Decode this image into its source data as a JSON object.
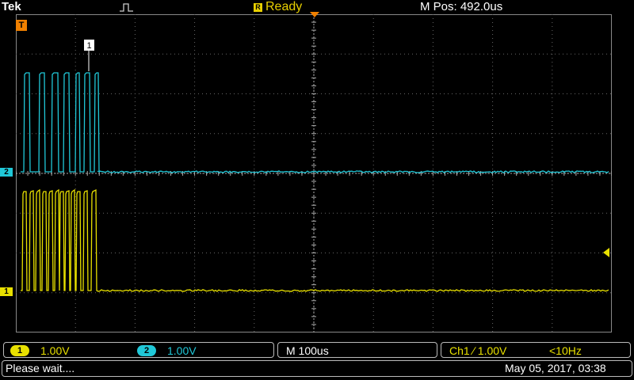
{
  "header": {
    "brand": "Tek",
    "status": "Ready",
    "status_icon": "R",
    "mpos": "M Pos: 492.0us"
  },
  "markers": {
    "trigger_point": "T",
    "ch2": "2",
    "ch1": "1",
    "callout": "1"
  },
  "colors": {
    "ch1": "#e8e000",
    "ch2": "#20c8d8",
    "trigger": "#f08000"
  },
  "footer": {
    "ch1_badge": "1",
    "ch1_scale": "1.00V",
    "ch2_badge": "2",
    "ch2_scale": "1.00V",
    "timebase": "M 100us",
    "trigger": "Ch1 ∕ 1.00V",
    "freq": "<10Hz",
    "message": "Please wait....",
    "datetime": "May 05, 2017, 03:38"
  },
  "icons": {
    "trigger_type": "edge-pulse-icon",
    "trigger_level": "trigger-level-arrow-icon",
    "trigger_position": "trigger-position-icon"
  }
}
